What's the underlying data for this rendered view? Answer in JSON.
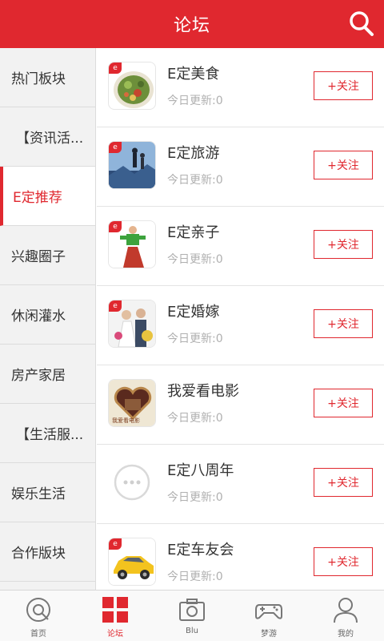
{
  "header": {
    "title": "论坛"
  },
  "sidebar": {
    "items": [
      {
        "label": "热门板块"
      },
      {
        "label": "【资讯活..."
      },
      {
        "label": "E定推荐"
      },
      {
        "label": "兴趣圈子"
      },
      {
        "label": "休闲灌水"
      },
      {
        "label": "房产家居"
      },
      {
        "label": "【生活服..."
      },
      {
        "label": "娱乐生活"
      },
      {
        "label": "合作版块"
      }
    ]
  },
  "forums": [
    {
      "name": "E定美食",
      "meta": "今日更新:0",
      "follow": "+关注",
      "badge": "e",
      "icon": "food-salad-icon"
    },
    {
      "name": "E定旅游",
      "meta": "今日更新:0",
      "follow": "+关注",
      "badge": "e",
      "icon": "travel-mountain-icon"
    },
    {
      "name": "E定亲子",
      "meta": "今日更新:0",
      "follow": "+关注",
      "badge": "e",
      "icon": "parent-child-icon"
    },
    {
      "name": "E定婚嫁",
      "meta": "今日更新:0",
      "follow": "+关注",
      "badge": "e",
      "icon": "wedding-couple-icon"
    },
    {
      "name": "我爱看电影",
      "meta": "今日更新:0",
      "follow": "+关注",
      "badge": "我爱看电影",
      "icon": "film-heart-icon"
    },
    {
      "name": "E定八周年",
      "meta": "今日更新:0",
      "follow": "+关注",
      "icon": "chat-bubble-icon"
    },
    {
      "name": "E定车友会",
      "meta": "今日更新:0",
      "follow": "+关注",
      "badge": "e",
      "icon": "car-icon"
    }
  ],
  "tabbar": {
    "items": [
      {
        "label": "首页",
        "icon": "home-icon"
      },
      {
        "label": "论坛",
        "icon": "grid-icon"
      },
      {
        "label": "Blu",
        "icon": "camera-icon"
      },
      {
        "label": "梦游",
        "icon": "gamepad-icon"
      },
      {
        "label": "我的",
        "icon": "profile-icon"
      }
    ]
  },
  "colors": {
    "accent": "#e0282f",
    "sidebar_bg": "#f2f2f2",
    "meta_text": "#b0b0b0"
  }
}
